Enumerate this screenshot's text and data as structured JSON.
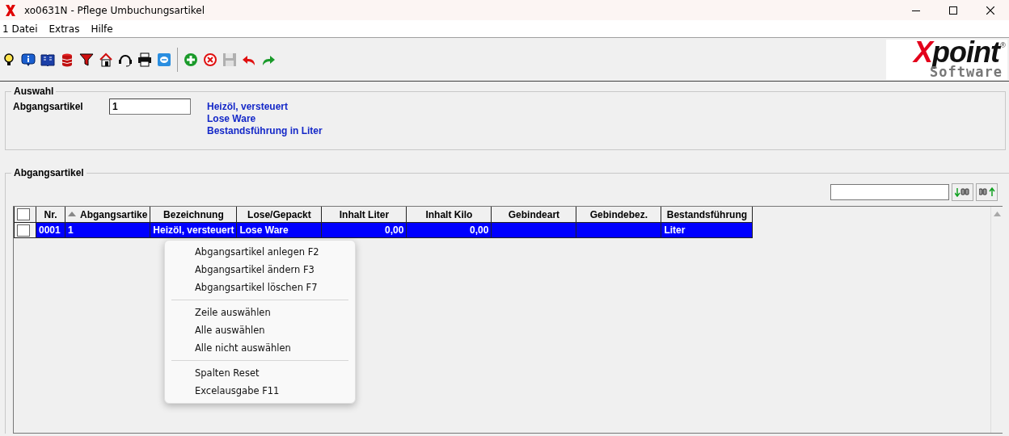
{
  "window": {
    "title": "xo0631N - Pflege Umbuchungsartikel"
  },
  "menu": [
    "1 Datei",
    "Extras",
    "Hilfe"
  ],
  "logo": {
    "brand_mark": "X",
    "brand_rest": "point",
    "registered": "®",
    "tagline": "Software"
  },
  "auswahl": {
    "title": "Auswahl",
    "label": "Abgangsartikel",
    "value": "1",
    "info": [
      "Heizöl, versteuert",
      "Lose Ware",
      "Bestandsführung in Liter"
    ]
  },
  "list": {
    "title": "Abgangsartikel",
    "header_checkbox": {
      "checked": false
    },
    "columns": [
      {
        "label": "Nr.",
        "kind": "text",
        "sorted": false
      },
      {
        "label": "Abgangsartike",
        "kind": "text",
        "sorted": true
      },
      {
        "label": "Bezeichnung",
        "kind": "text",
        "sorted": false
      },
      {
        "label": "Lose/Gepackt",
        "kind": "text",
        "sorted": false
      },
      {
        "label": "Inhalt Liter",
        "kind": "number",
        "sorted": false
      },
      {
        "label": "Inhalt Kilo",
        "kind": "number",
        "sorted": false
      },
      {
        "label": "Gebindeart",
        "kind": "text",
        "sorted": false
      },
      {
        "label": "Gebindebez.",
        "kind": "text",
        "sorted": false
      },
      {
        "label": "Bestandsführung",
        "kind": "text",
        "sorted": false
      }
    ],
    "rows": [
      {
        "checked": false,
        "selected": true,
        "cells": [
          "0001",
          "1",
          "Heizöl, versteuert",
          "Lose Ware",
          "0,00",
          "0,00",
          "",
          "",
          "Liter"
        ]
      }
    ]
  },
  "context_menu": [
    {
      "kind": "item",
      "label": "Abgangsartikel anlegen F2"
    },
    {
      "kind": "item",
      "label": "Abgangsartikel ändern F3"
    },
    {
      "kind": "item",
      "label": "Abgangsartikel löschen F7"
    },
    {
      "kind": "separator"
    },
    {
      "kind": "item",
      "label": "Zeile auswählen"
    },
    {
      "kind": "item",
      "label": "Alle auswählen"
    },
    {
      "kind": "item",
      "label": "Alle nicht auswählen"
    },
    {
      "kind": "separator"
    },
    {
      "kind": "item",
      "label": "Spalten Reset"
    },
    {
      "kind": "item",
      "label": "Excelausgabe F11"
    }
  ]
}
